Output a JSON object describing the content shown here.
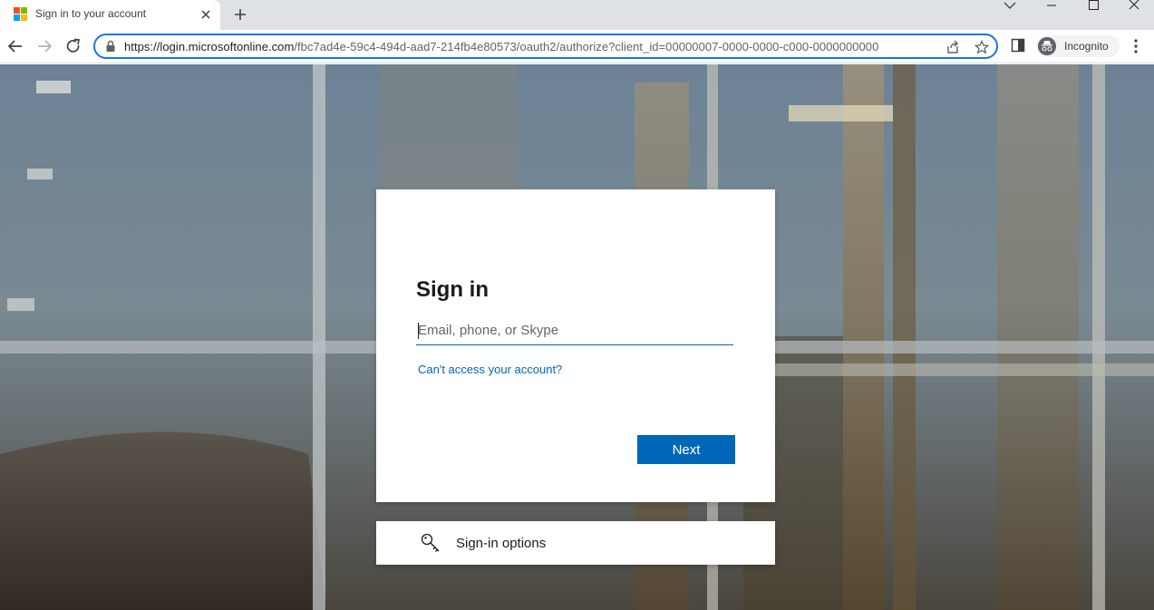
{
  "browser": {
    "tab_title": "Sign in to your account",
    "url_host": "https://login.microsoftonline.com",
    "url_path": "/fbc7ad4e-59c4-494d-aad7-214fb4e80573/oauth2/authorize?client_id=00000007-0000-0000-c000-0000000000",
    "profile_label": "Incognito",
    "accent_color": "#1a73e8"
  },
  "signin": {
    "heading": "Sign in",
    "email_placeholder": "Email, phone, or Skype",
    "cant_access_link": "Can't access your account?",
    "next_button": "Next",
    "brand_color": "#0067b8"
  },
  "options": {
    "label": "Sign-in options"
  },
  "icons": [
    "microsoft-favicon",
    "close-icon",
    "plus-icon",
    "chevron-down-icon",
    "minimize-icon",
    "maximize-icon",
    "window-close-icon",
    "back-arrow-icon",
    "forward-arrow-icon",
    "reload-icon",
    "lock-icon",
    "share-icon",
    "star-icon",
    "side-panel-icon",
    "incognito-icon",
    "kebab-menu-icon",
    "key-icon"
  ]
}
